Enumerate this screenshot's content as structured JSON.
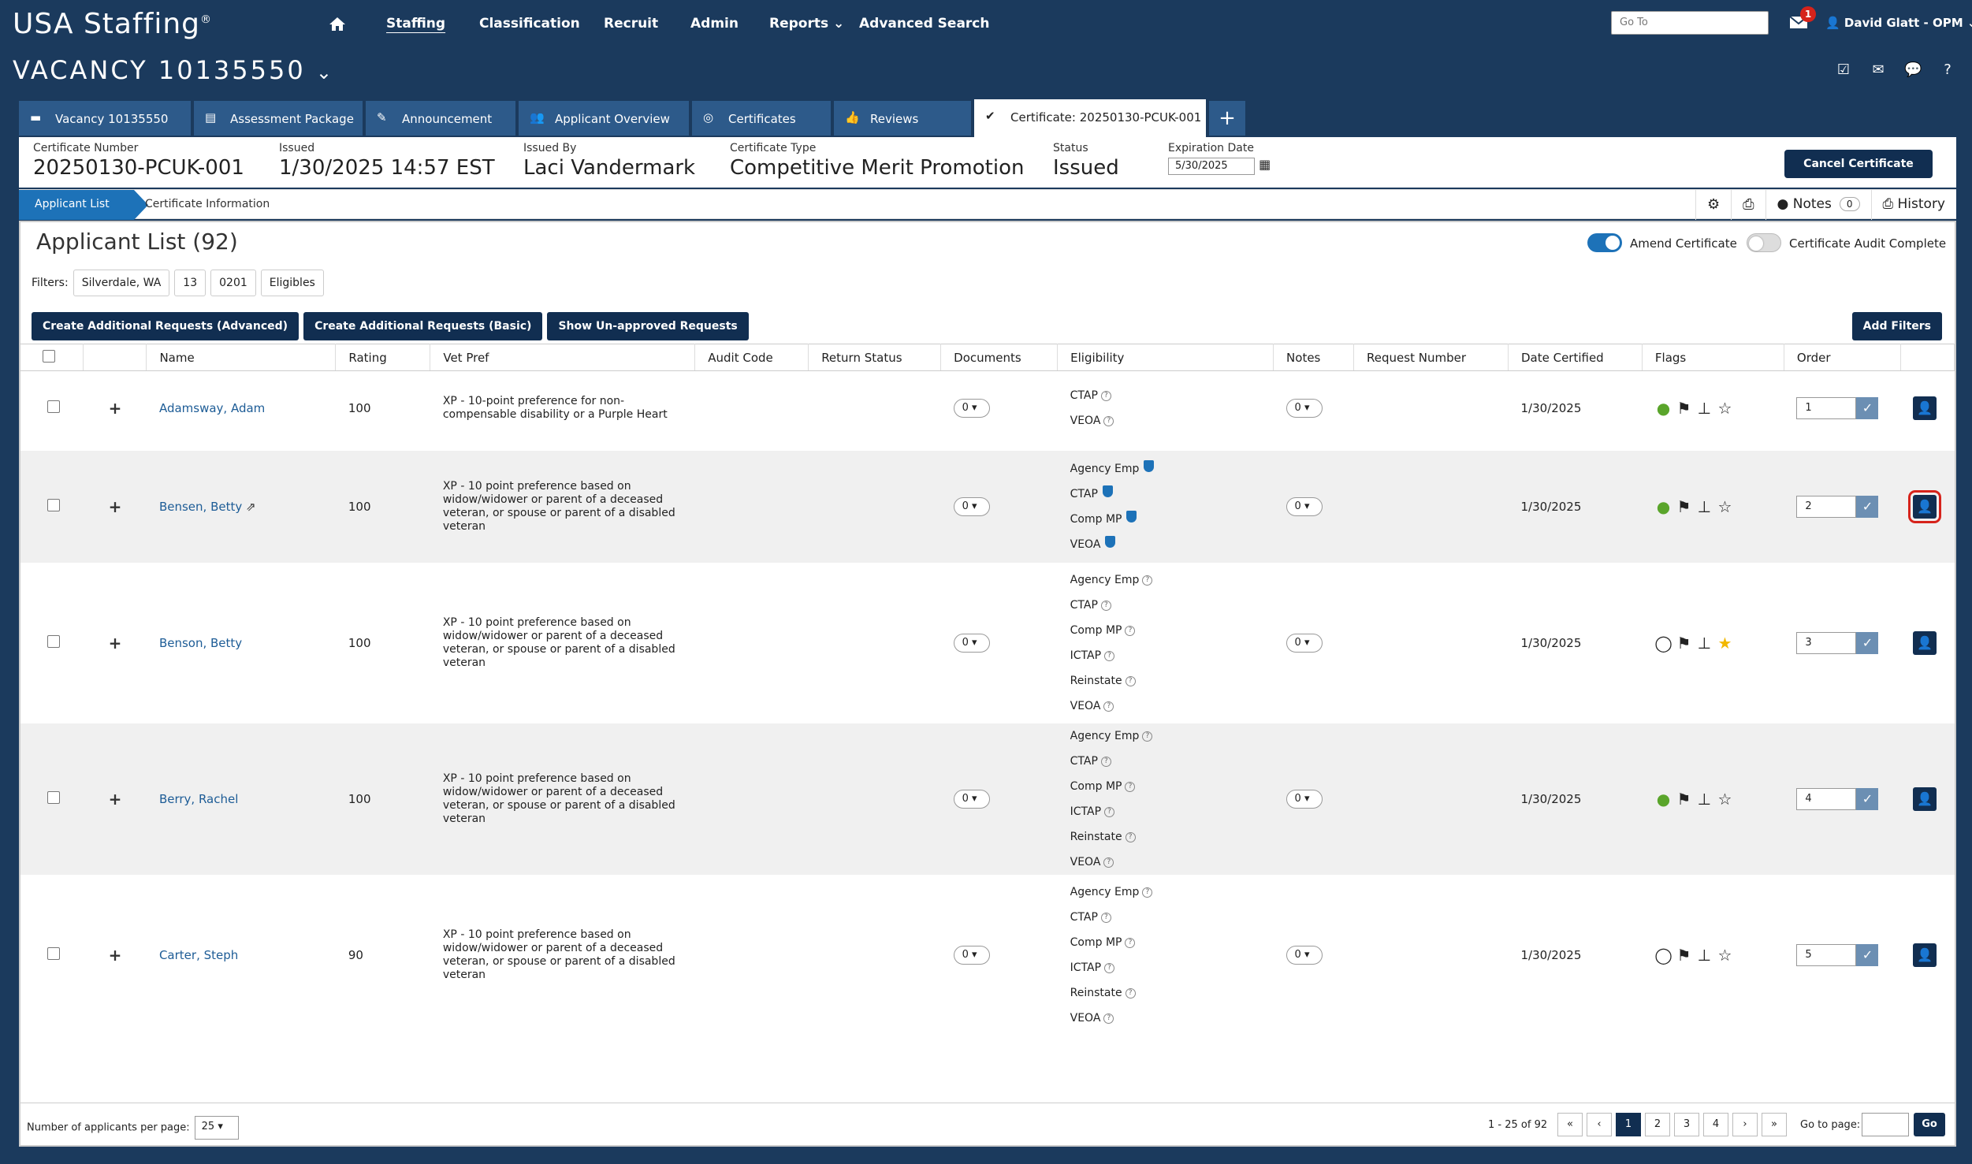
{
  "app": {
    "logo": "USA Staffing",
    "logo_mark": "®"
  },
  "nav": {
    "items": [
      {
        "label": "Staffing",
        "active": true
      },
      {
        "label": "Classification"
      },
      {
        "label": "Recruit"
      },
      {
        "label": "Admin"
      },
      {
        "label": "Reports"
      },
      {
        "label": "Advanced Search"
      }
    ],
    "goto_placeholder": "Go To",
    "mail_badge": "1",
    "user": "David Glatt - OPM"
  },
  "vacancy": {
    "title": "VACANCY 10135550"
  },
  "tabs": [
    {
      "label": "Vacancy 10135550",
      "icon": "briefcase-icon"
    },
    {
      "label": "Assessment Package",
      "icon": "package-icon"
    },
    {
      "label": "Announcement",
      "icon": "megaphone-icon"
    },
    {
      "label": "Applicant Overview",
      "icon": "users-icon"
    },
    {
      "label": "Certificates",
      "icon": "certificate-icon"
    },
    {
      "label": "Reviews",
      "icon": "thumbs-up-icon"
    },
    {
      "label": "Certificate: 20250130-PCUK-001",
      "icon": "check-circle-icon",
      "active": true
    }
  ],
  "cert": {
    "number_label": "Certificate Number",
    "number": "20250130-PCUK-001",
    "issued_label": "Issued",
    "issued": "1/30/2025 14:57 EST",
    "by_label": "Issued By",
    "by": "Laci Vandermark",
    "type_label": "Certificate Type",
    "type": "Competitive Merit Promotion",
    "status_label": "Status",
    "status": "Issued",
    "exp_label": "Expiration Date",
    "exp": "5/30/2025",
    "cancel": "Cancel Certificate"
  },
  "subnav": {
    "crumb1": "Applicant List",
    "crumb2": "Certificate Information",
    "notes": "Notes",
    "notes_count": "0",
    "history": "History"
  },
  "list": {
    "title": "Applicant List (92)",
    "amend": "Amend Certificate",
    "audit": "Certificate Audit Complete",
    "filters_label": "Filters:",
    "filters": [
      "Silverdale, WA",
      "13",
      "0201",
      "Eligibles"
    ],
    "buttons": [
      "Create Additional Requests (Advanced)",
      "Create Additional Requests (Basic)",
      "Show Un-approved Requests"
    ],
    "add_filters": "Add Filters",
    "columns": [
      "Name",
      "Rating",
      "Vet Pref",
      "Audit Code",
      "Return Status",
      "Documents",
      "Eligibility",
      "Notes",
      "Request Number",
      "Date Certified",
      "Flags",
      "Order"
    ]
  },
  "rows": [
    {
      "name": "Adamsway, Adam",
      "rating": "100",
      "vet": "XP - 10-point preference for non-compensable disability or a Purple Heart",
      "docs": "0",
      "notes": "0",
      "date": "1/30/2025",
      "order": "1",
      "elig": [
        {
          "t": "CTAP",
          "v": false
        },
        {
          "t": "VEOA",
          "v": false
        }
      ],
      "flag_ok": true,
      "star": false
    },
    {
      "name": "Bensen, Betty",
      "rating": "100",
      "vet": "XP - 10 point preference based on widow/widower or parent of a deceased veteran, or spouse or parent of a disabled veteran",
      "docs": "0",
      "notes": "0",
      "date": "1/30/2025",
      "order": "2",
      "elig": [
        {
          "t": "Agency Emp",
          "v": true
        },
        {
          "t": "CTAP",
          "v": true
        },
        {
          "t": "Comp MP",
          "v": true
        },
        {
          "t": "VEOA",
          "v": true
        }
      ],
      "flag_ok": true,
      "star": false,
      "ext": true,
      "highlight": true
    },
    {
      "name": "Benson, Betty",
      "rating": "100",
      "vet": "XP - 10 point preference based on widow/widower or parent of a deceased veteran, or spouse or parent of a disabled veteran",
      "docs": "0",
      "notes": "0",
      "date": "1/30/2025",
      "order": "3",
      "elig": [
        {
          "t": "Agency Emp",
          "v": false
        },
        {
          "t": "CTAP",
          "v": false
        },
        {
          "t": "Comp MP",
          "v": false
        },
        {
          "t": "ICTAP",
          "v": false
        },
        {
          "t": "Reinstate",
          "v": false
        },
        {
          "t": "VEOA",
          "v": false
        }
      ],
      "flag_ok": false,
      "star": true
    },
    {
      "name": "Berry, Rachel",
      "rating": "100",
      "vet": "XP - 10 point preference based on widow/widower or parent of a deceased veteran, or spouse or parent of a disabled veteran",
      "docs": "0",
      "notes": "0",
      "date": "1/30/2025",
      "order": "4",
      "elig": [
        {
          "t": "Agency Emp",
          "v": false
        },
        {
          "t": "CTAP",
          "v": false
        },
        {
          "t": "Comp MP",
          "v": false
        },
        {
          "t": "ICTAP",
          "v": false
        },
        {
          "t": "Reinstate",
          "v": false
        },
        {
          "t": "VEOA",
          "v": false
        }
      ],
      "flag_ok": true,
      "star": false
    },
    {
      "name": "Carter, Steph",
      "rating": "90",
      "vet": "XP - 10 point preference based on widow/widower or parent of a deceased veteran, or spouse or parent of a disabled veteran",
      "docs": "0",
      "notes": "0",
      "date": "1/30/2025",
      "order": "5",
      "elig": [
        {
          "t": "Agency Emp",
          "v": false
        },
        {
          "t": "CTAP",
          "v": false
        },
        {
          "t": "Comp MP",
          "v": false
        },
        {
          "t": "ICTAP",
          "v": false
        },
        {
          "t": "Reinstate",
          "v": false
        },
        {
          "t": "VEOA",
          "v": false
        }
      ],
      "flag_ok": false,
      "star": false
    }
  ],
  "footer": {
    "perpage_label": "Number of applicants per page:",
    "perpage": "25",
    "range": "1 - 25 of 92",
    "pages": [
      "«",
      "‹",
      "1",
      "2",
      "3",
      "4",
      "›",
      "»"
    ],
    "current": "1",
    "goto_label": "Go to page:",
    "go": "Go"
  },
  "colors": {
    "navy": "#1b3a5d",
    "button": "#112e51",
    "accent": "#1d72b8",
    "highlight": "#d6231b"
  }
}
